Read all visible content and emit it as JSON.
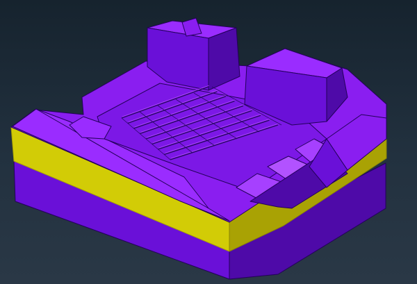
{
  "viewport": {
    "name": "cad-3d-viewport",
    "background_top": "#16232e",
    "background_bottom": "#2a3846"
  },
  "model": {
    "name": "mold-base-model",
    "colors": {
      "top_face": "#8a1ef0",
      "top_face_light": "#9a2cff",
      "side_face": "#6a10d8",
      "side_face_dark": "#4e0aa8",
      "edge": "#23005a",
      "plate_band": "#d2cc06",
      "plate_band_shadow": "#a9a204",
      "highlight": "#c35cff"
    }
  }
}
